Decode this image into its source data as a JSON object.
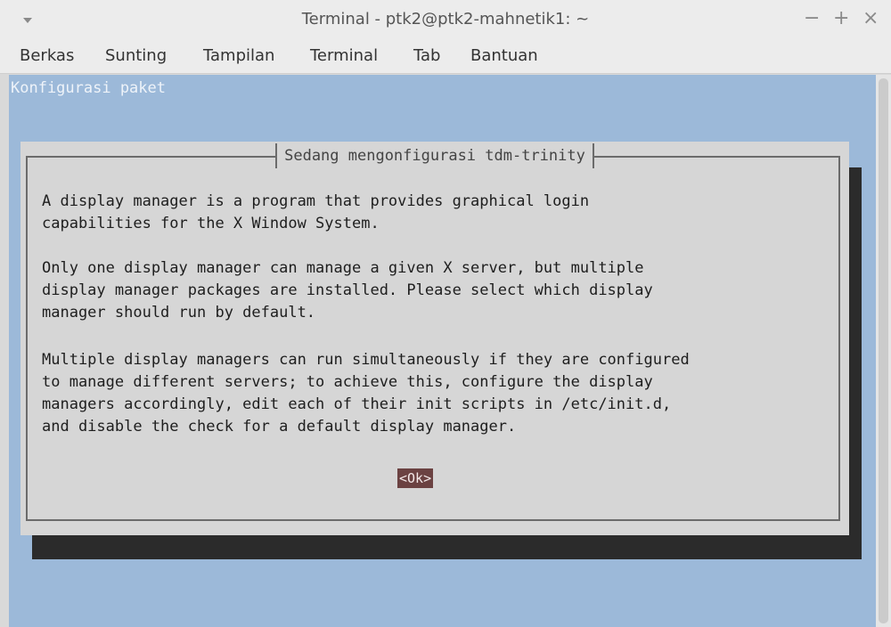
{
  "window": {
    "title": "Terminal - ptk2@ptk2-mahnetik1: ~",
    "controls": {
      "minimize": "−",
      "maximize": "+",
      "close": "×"
    }
  },
  "menubar": {
    "items": [
      "Berkas",
      "Sunting",
      "Tampilan",
      "Terminal",
      "Tab",
      "Bantuan"
    ]
  },
  "terminal": {
    "background_title": "Konfigurasi paket",
    "dialog": {
      "title": "Sedang mengonfigurasi tdm-trinity",
      "paragraphs": [
        "A display manager is a program that provides graphical login\ncapabilities for the X Window System.",
        "Only one display manager can manage a given X server, but multiple\ndisplay manager packages are installed. Please select which display\nmanager should run by default.",
        "Multiple display managers can run simultaneously if they are configured\nto manage different servers; to achieve this, configure the display\nmanagers accordingly, edit each of their init scripts in /etc/init.d,\nand disable the check for a default display manager."
      ],
      "ok_label": "<Ok>"
    }
  },
  "colors": {
    "terminal_bg": "#9cb9d9",
    "dialog_bg": "#d6d6d6",
    "ok_button_bg": "#6b4242",
    "shadow": "#2b2b2b"
  }
}
